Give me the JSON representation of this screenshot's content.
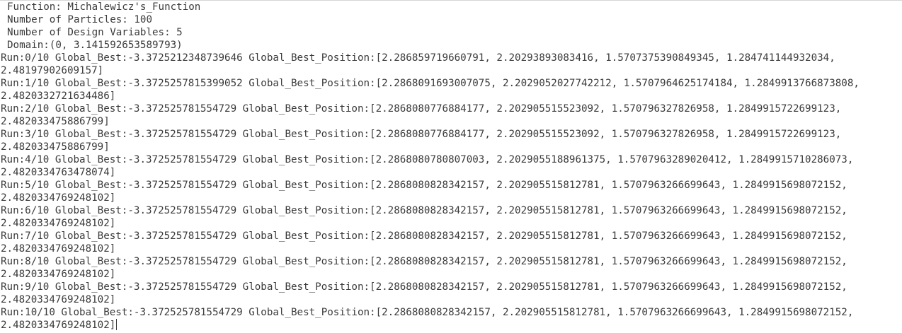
{
  "header": {
    "function_line": "Function: Michalewicz's_Function",
    "particles_line": "Number of Particles: 100",
    "variables_line": "Number of Design Variables: 5",
    "domain_line": "Domain:(0, 3.141592653589793)"
  },
  "runs": [
    {
      "line1": "Run:0/10 Global_Best:-3.3725212348739646 Global_Best_Position:[2.286859719660791, 2.20293893083416, 1.5707375390849345, 1.284741144932034,",
      "line2": "2.48197902609157]"
    },
    {
      "line1": "Run:1/10 Global_Best:-3.3725257815399052 Global_Best_Position:[2.2868091693007075, 2.2029052027742212, 1.5707964625174184, 1.2849913766873808,",
      "line2": "2.4820332721634486]"
    },
    {
      "line1": "Run:2/10 Global_Best:-3.372525781554729 Global_Best_Position:[2.2868080776884177, 2.202905515523092, 1.570796327826958, 1.2849915722699123,",
      "line2": "2.482033475886799]"
    },
    {
      "line1": "Run:3/10 Global_Best:-3.372525781554729 Global_Best_Position:[2.2868080776884177, 2.202905515523092, 1.570796327826958, 1.2849915722699123,",
      "line2": "2.482033475886799]"
    },
    {
      "line1": "Run:4/10 Global_Best:-3.372525781554729 Global_Best_Position:[2.2868080780807003, 2.2029055188961375, 1.5707963289020412, 1.2849915710286073,",
      "line2": "2.4820334763478074]"
    },
    {
      "line1": "Run:5/10 Global_Best:-3.372525781554729 Global_Best_Position:[2.2868080828342157, 2.202905515812781, 1.5707963266699643, 1.2849915698072152,",
      "line2": "2.4820334769248102]"
    },
    {
      "line1": "Run:6/10 Global_Best:-3.372525781554729 Global_Best_Position:[2.2868080828342157, 2.202905515812781, 1.5707963266699643, 1.2849915698072152,",
      "line2": "2.4820334769248102]"
    },
    {
      "line1": "Run:7/10 Global_Best:-3.372525781554729 Global_Best_Position:[2.2868080828342157, 2.202905515812781, 1.5707963266699643, 1.2849915698072152,",
      "line2": "2.4820334769248102]"
    },
    {
      "line1": "Run:8/10 Global_Best:-3.372525781554729 Global_Best_Position:[2.2868080828342157, 2.202905515812781, 1.5707963266699643, 1.2849915698072152,",
      "line2": "2.4820334769248102]"
    },
    {
      "line1": "Run:9/10 Global_Best:-3.372525781554729 Global_Best_Position:[2.2868080828342157, 2.202905515812781, 1.5707963266699643, 1.2849915698072152,",
      "line2": "2.4820334769248102]"
    },
    {
      "line1": "Run:10/10 Global_Best:-3.372525781554729 Global_Best_Position:[2.2868080828342157, 2.202905515812781, 1.5707963266699643, 1.2849915698072152,",
      "line2": "2.4820334769248102]"
    }
  ],
  "colors": {
    "background": "#ffffff",
    "text": "#3b3b3b"
  }
}
